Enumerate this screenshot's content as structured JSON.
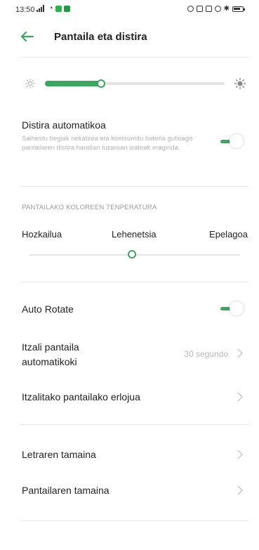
{
  "status_bar": {
    "time": "13:50"
  },
  "header": {
    "title": "Pantaila eta distira"
  },
  "brightness": {
    "level_fraction": 0.32
  },
  "auto_brightness": {
    "title": "Distira automatikoa",
    "description": "Saihestu begiak nekatzea eta kontsumitu bateria gutxiago pantailaren distira handian luzaroan izateak eraginda.",
    "enabled": true
  },
  "color_temperature": {
    "section_label": "PANTAILAKO KOLOREEN TENPERATURA",
    "options": [
      "Hozkailua",
      "Lehenetsia",
      "Epelagoa"
    ],
    "selected": "Lehenetsia"
  },
  "auto_rotate": {
    "label": "Auto Rotate",
    "enabled": true
  },
  "screen_off": {
    "label_line1": "Itzali pantaila",
    "label_line2": "automatikoki",
    "value": "30 segundo"
  },
  "clock": {
    "label": "Itzalitako pantailako erlojua"
  },
  "font_size": {
    "label": "Letraren tamaina"
  },
  "display_size": {
    "label": "Pantailaren tamaina"
  },
  "colors": {
    "accent": "#3aa861"
  }
}
